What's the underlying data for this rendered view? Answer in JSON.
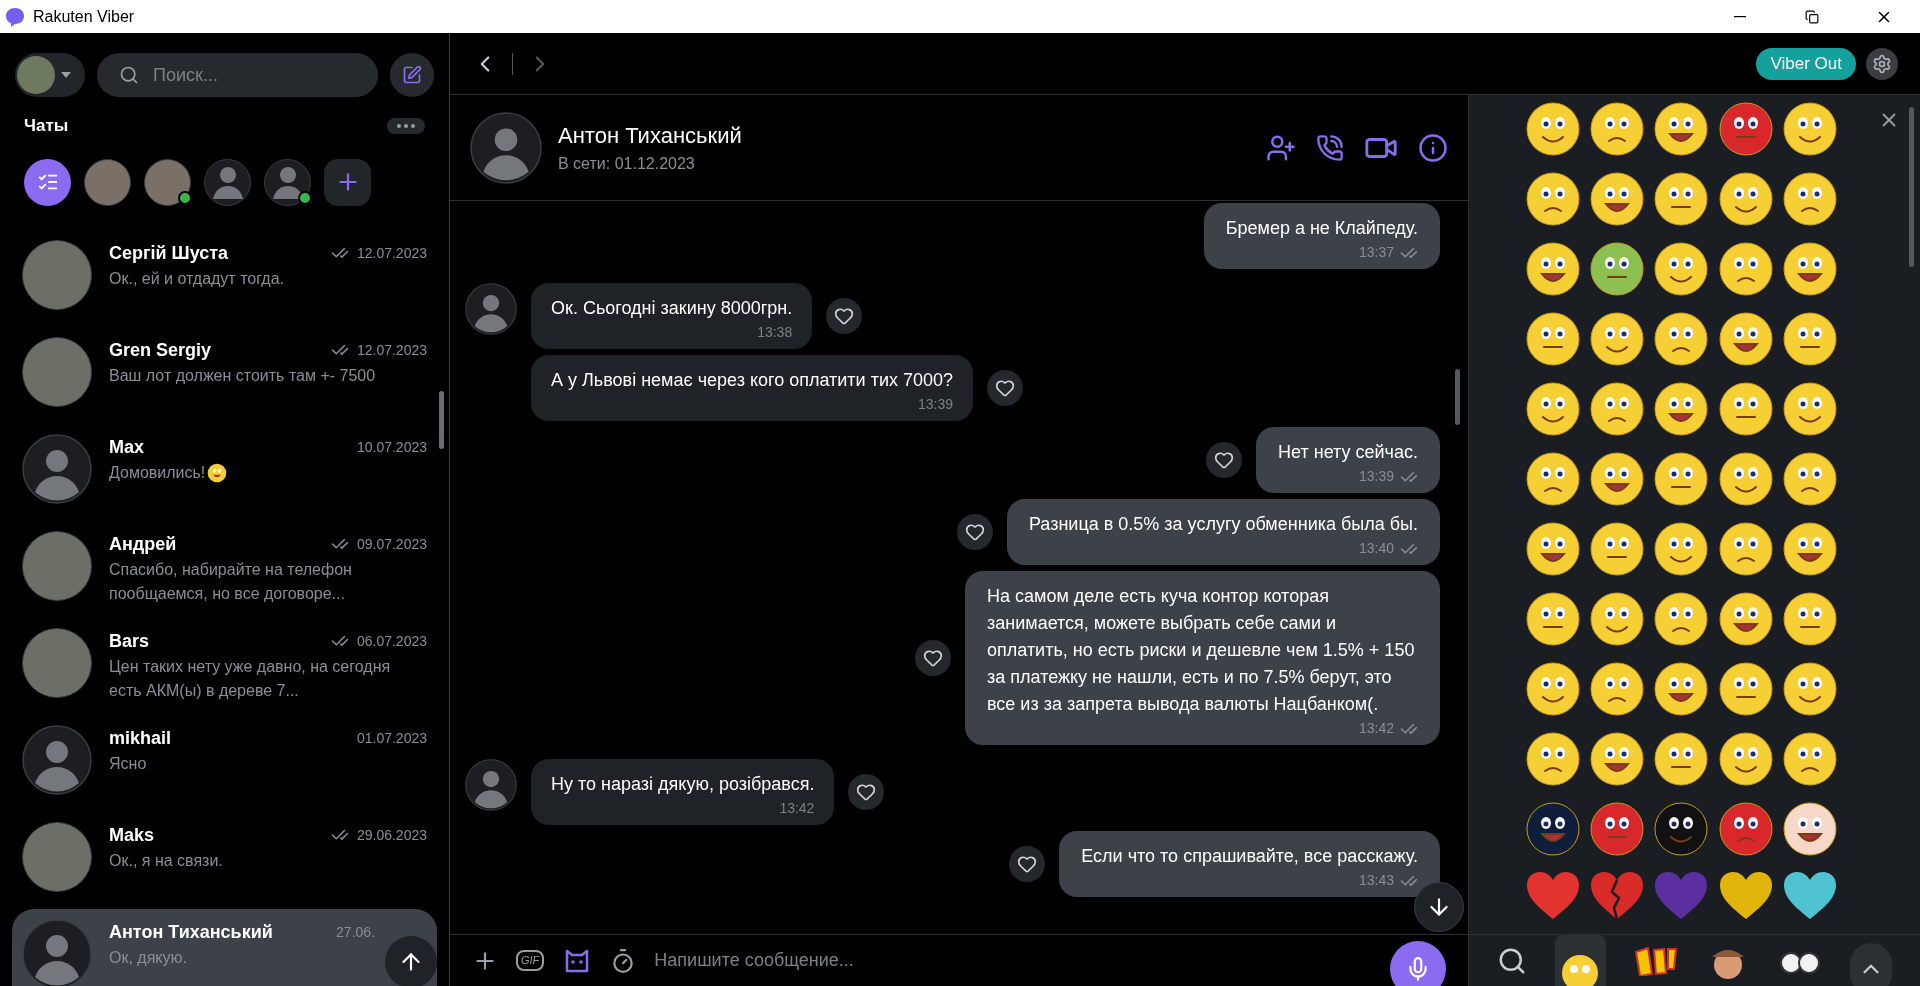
{
  "window": {
    "title": "Rakuten Viber"
  },
  "sidebar": {
    "search": {
      "placeholder": "Поиск..."
    },
    "section_title": "Чаты",
    "stories": [
      {
        "kind": "filter"
      },
      {
        "kind": "photo",
        "online": false
      },
      {
        "kind": "photo",
        "online": true
      },
      {
        "kind": "default",
        "online": false
      },
      {
        "kind": "default",
        "online": true
      },
      {
        "kind": "add"
      }
    ],
    "chats": [
      {
        "name": "Сергій Шуста",
        "date": "12.07.2023",
        "preview": "Ок., ей и отдадут тогда.",
        "has_photo": true,
        "ticks": true,
        "selected": false
      },
      {
        "name": "Gren Sergiy",
        "date": "12.07.2023",
        "preview": "Ваш лот должен стоить там +- 7500",
        "has_photo": true,
        "ticks": true,
        "selected": false
      },
      {
        "name": "Max",
        "date": "10.07.2023",
        "preview": "Домовились!",
        "trailing_emoji": true,
        "has_photo": false,
        "ticks": false,
        "selected": false
      },
      {
        "name": "Андрей",
        "date": "09.07.2023",
        "preview": "Спасибо, набирайте на телефон пообщаемся, но все договоре...",
        "has_photo": true,
        "ticks": true,
        "selected": false
      },
      {
        "name": "Bars",
        "date": "06.07.2023",
        "preview": "Цен таких нету уже давно, на сегодня есть АКМ(ы) в дереве 7...",
        "has_photo": true,
        "ticks": true,
        "selected": false
      },
      {
        "name": "mikhail",
        "date": "01.07.2023",
        "preview": "Ясно",
        "has_photo": false,
        "ticks": false,
        "selected": false
      },
      {
        "name": "Maks",
        "date": "29.06.2023",
        "preview": "Ок., я на связи.",
        "has_photo": true,
        "ticks": true,
        "selected": false
      },
      {
        "name": "Антон Тиханський",
        "date": "27.06.",
        "preview": "Ок, дякую.",
        "has_photo": false,
        "ticks": false,
        "selected": true
      }
    ]
  },
  "top_bar": {
    "viber_out": "Viber Out"
  },
  "chat": {
    "name": "Антон Тиханський",
    "status": "В сети: 01.12.2023",
    "messages": [
      {
        "kind": "out",
        "text": "Бремер а не Клайпеду.",
        "time": "13:37",
        "ticks": true,
        "like_button": false
      },
      {
        "kind": "in",
        "text": "Ок. Сьогодні закину 8000грн.",
        "time": "13:38",
        "avatar": true,
        "like_button": true
      },
      {
        "kind": "in",
        "text": "А у Львові немає через кого оплатити тих 7000?",
        "time": "13:39",
        "avatar": false,
        "like_button": true
      },
      {
        "kind": "out",
        "text": "Нет нету сейчас.",
        "time": "13:39",
        "ticks": true,
        "like_button": true
      },
      {
        "kind": "out",
        "text": "Разница в 0.5% за услугу обменника была бы.",
        "time": "13:40",
        "ticks": true,
        "like_button": true
      },
      {
        "kind": "out",
        "text": "На самом деле есть куча контор которая занимается, можете выбрать себе сами и оплатить, но есть риски и дешевле чем 1.5% + 150 за платежку не нашли, есть и по 7.5% берут, это все из за запрета вывода валюты Нацбанком(.",
        "time": "13:42",
        "ticks": true,
        "like_button": true
      },
      {
        "kind": "in",
        "text": "Ну то наразі дякую, розібрався.",
        "time": "13:42",
        "avatar": true,
        "like_button": true
      },
      {
        "kind": "out",
        "text": "Если что то спрашивайте, все расскажу.",
        "time": "13:43",
        "ticks": true,
        "like_button": true
      }
    ]
  },
  "composer": {
    "gif_button": "GIF",
    "placeholder": "Напишите сообщение..."
  }
}
